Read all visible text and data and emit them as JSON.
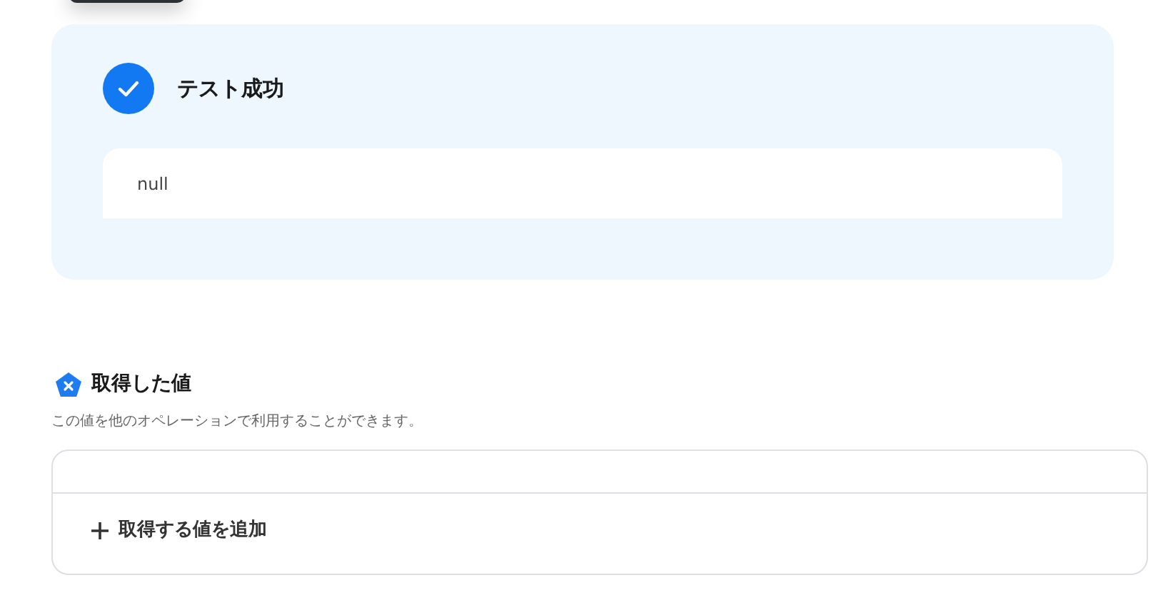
{
  "test_result": {
    "title": "テスト成功",
    "success": true,
    "output": "null"
  },
  "captured_values": {
    "title": "取得した値",
    "description": "この値を他のオペレーションで利用することができます。",
    "add_button": "取得する値を追加"
  }
}
